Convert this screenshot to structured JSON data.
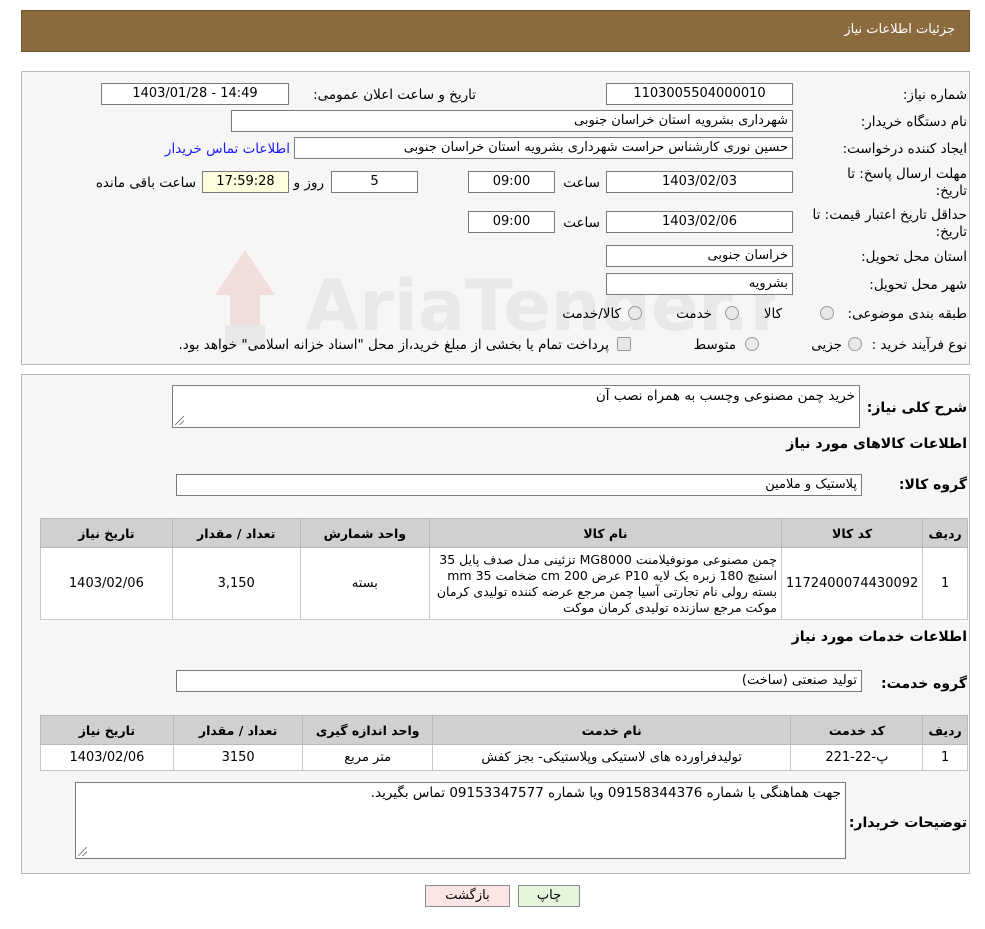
{
  "header": {
    "title": "جزئیات اطلاعات نیاز"
  },
  "watermark": {
    "text": "AriaTender.neT"
  },
  "form": {
    "need_number_label": "شماره نیاز:",
    "need_number": "1103005504000010",
    "announce_label": "تاریخ و ساعت اعلان عمومی:",
    "announce_value": "1403/01/28 - 14:49",
    "buyer_org_label": "نام دستگاه خریدار:",
    "buyer_org": "شهرداری بشرویه استان خراسان جنوبی",
    "creator_label": "ایجاد کننده درخواست:",
    "creator": "حسین نوری کارشناس حراست شهرداری بشرویه استان خراسان جنوبی",
    "contact_link": "اطلاعات تماس خریدار",
    "reply_deadline_label_1": "مهلت ارسال پاسخ: تا",
    "reply_deadline_label_2": "تاریخ:",
    "reply_date": "1403/02/03",
    "time_label": "ساعت",
    "reply_time": "09:00",
    "days_value": "5",
    "days_label": "روز و",
    "remaining_time": "17:59:28",
    "remaining_label": "ساعت باقی مانده",
    "validity_label_1": "حداقل تاریخ اعتبار قیمت: تا",
    "validity_label_2": "تاریخ:",
    "validity_date": "1403/02/06",
    "validity_time": "09:00",
    "province_label": "استان محل تحویل:",
    "province": "خراسان جنوبی",
    "city_label": "شهر محل تحویل:",
    "city": "بشرویه",
    "category_label": "طبقه بندی موضوعی:",
    "category_options": [
      "کالا",
      "خدمت",
      "کالا/خدمت"
    ],
    "process_label": "نوع فرآیند خرید :",
    "process_options": [
      "جزیی",
      "متوسط"
    ],
    "process_note": "پرداخت تمام یا بخشی از مبلغ خرید،از محل \"اسناد خزانه اسلامی\" خواهد بود."
  },
  "details": {
    "summary_label": "شرح کلی نیاز:",
    "summary": "خرید چمن مصنوعی وچسب به همراه نصب آن",
    "goods_title": "اطلاعات کالاهای مورد نیاز",
    "goods_group_label": "گروه کالا:",
    "goods_group": "پلاستیک و ملامین",
    "goods_table": {
      "headers": [
        "ردیف",
        "کد کالا",
        "نام کالا",
        "واحد شمارش",
        "تعداد / مقدار",
        "تاریخ نیاز"
      ],
      "rows": [
        [
          "1",
          "1172400074430092",
          "چمن مصنوعی مونوفیلامنت MG8000 تزئینی مدل صدف پایل 35 استیچ 180 زبره یک لایه P10 عرض 200 cm ضخامت 35 mm بسته رولی نام تجارتی آسیا چمن مرجع عرضه کننده تولیدی کرمان موکت مرجع سازنده تولیدی کرمان موکت",
          "بسته",
          "3,150",
          "1403/02/06"
        ]
      ]
    },
    "services_title": "اطلاعات خدمات مورد نیاز",
    "service_group_label": "گروه خدمت:",
    "service_group": "تولید صنعتی (ساخت)",
    "services_table": {
      "headers": [
        "ردیف",
        "کد خدمت",
        "نام خدمت",
        "واحد اندازه گیری",
        "تعداد / مقدار",
        "تاریخ نیاز"
      ],
      "rows": [
        [
          "1",
          "پ-22-221",
          "تولیدفراورده های لاستیکی وپلاستیکی- بجز کفش",
          "متر مربع",
          "3150",
          "1403/02/06"
        ]
      ]
    },
    "buyer_notes_label": "توضیحات خریدار:",
    "buyer_notes": "جهت هماهنگی با شماره 09158344376 ویا شماره 09153347577 تماس بگیرید."
  },
  "buttons": {
    "print": "چاپ",
    "back": "بازگشت"
  },
  "colors": {
    "header_bg": "#8b6a3e",
    "time_bg": "#ffffe0",
    "print_bg": "#e4f5dc",
    "back_bg": "#fbe4e4"
  }
}
